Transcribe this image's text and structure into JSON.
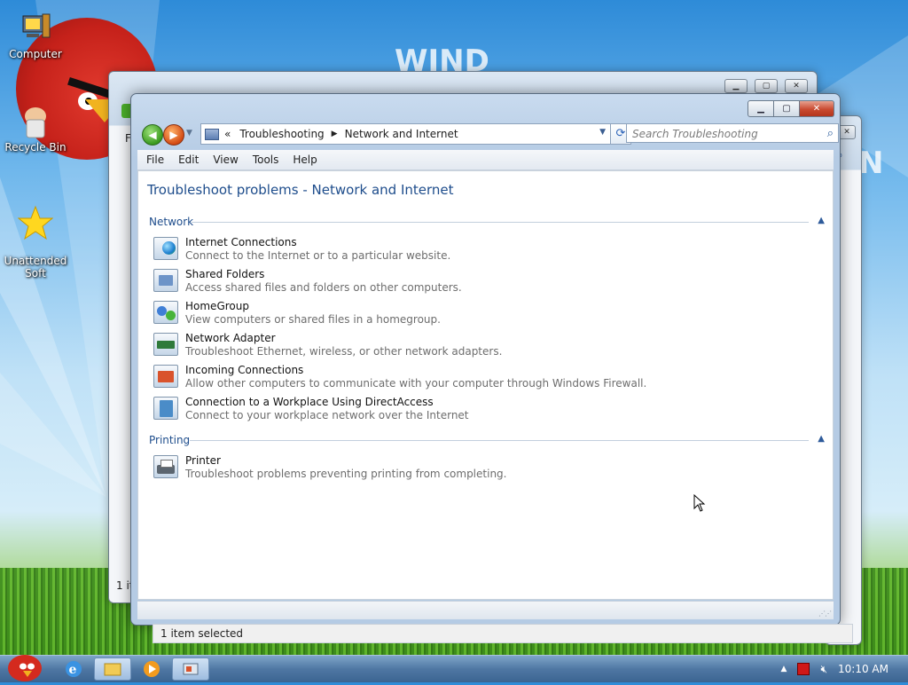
{
  "desktop": {
    "icons": [
      {
        "label": "Computer",
        "icon": "computer-icon"
      },
      {
        "label": "Recycle Bin",
        "icon": "recycle-bin-icon"
      },
      {
        "label": "Unattended\nSoft",
        "icon": "star-icon"
      }
    ]
  },
  "window": {
    "address": {
      "prefix": "«",
      "crumbs": [
        "Troubleshooting",
        "Network and Internet"
      ]
    },
    "search_placeholder": "Search Troubleshooting",
    "menu": [
      "File",
      "Edit",
      "View",
      "Tools",
      "Help"
    ],
    "page_title": "Troubleshoot problems - Network and Internet",
    "groups": [
      {
        "name": "Network",
        "items": [
          {
            "title": "Internet Connections",
            "desc": "Connect to the Internet or to a particular website.",
            "icon": "internet-globe-icon"
          },
          {
            "title": "Shared Folders",
            "desc": "Access shared files and folders on other computers.",
            "icon": "shared-folders-icon"
          },
          {
            "title": "HomeGroup",
            "desc": "View computers or shared files in a homegroup.",
            "icon": "homegroup-icon"
          },
          {
            "title": "Network Adapter",
            "desc": "Troubleshoot Ethernet, wireless, or other network adapters.",
            "icon": "network-adapter-icon"
          },
          {
            "title": "Incoming Connections",
            "desc": "Allow other computers to communicate with your computer through Windows Firewall.",
            "icon": "incoming-connections-icon"
          },
          {
            "title": "Connection to a Workplace Using DirectAccess",
            "desc": "Connect to your workplace network over the Internet",
            "icon": "directaccess-icon"
          }
        ]
      },
      {
        "name": "Printing",
        "items": [
          {
            "title": "Printer",
            "desc": "Troubleshoot problems preventing printing from completing.",
            "icon": "printer-icon"
          }
        ]
      }
    ]
  },
  "background_window": {
    "status_text": "1 item selected",
    "left_status": "1 it"
  },
  "taskbar": {
    "clock": "10:10 AM"
  },
  "colors": {
    "link_blue": "#1e4d8c",
    "close_red": "#c94a30"
  }
}
